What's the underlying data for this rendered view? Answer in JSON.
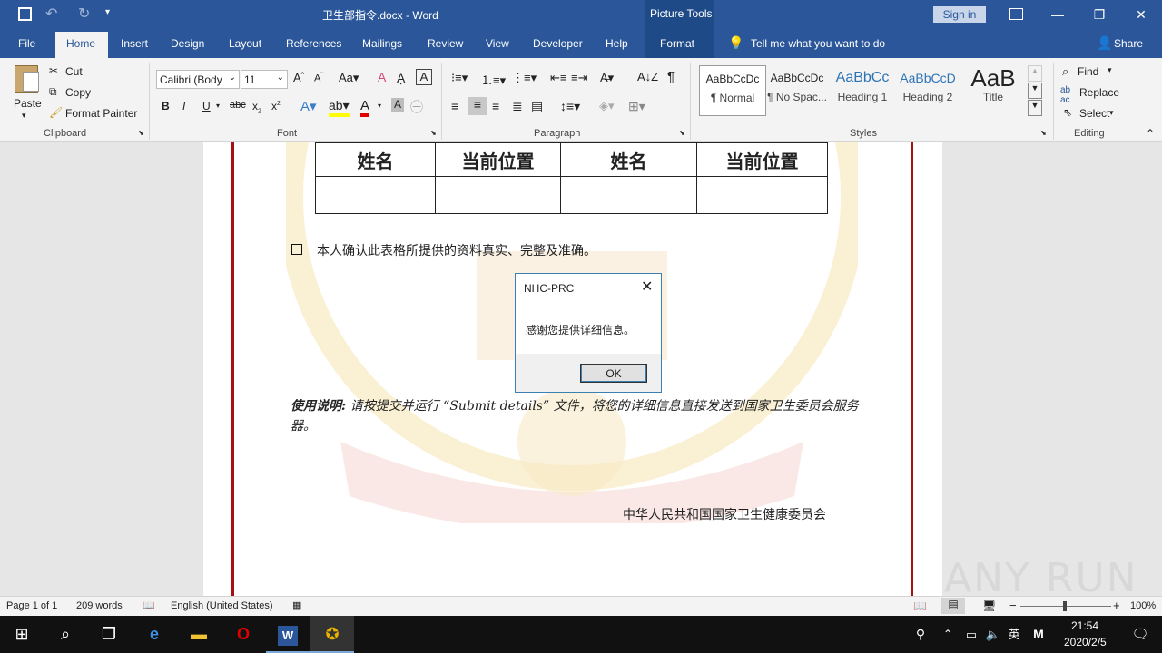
{
  "title_bar": {
    "doc_title": "卫生部指令.docx  -  Word",
    "context_tools": "Picture Tools",
    "sign_in": "Sign in",
    "minimize": "—",
    "restore": "❐",
    "close": "✕"
  },
  "tabs": {
    "file": "File",
    "home": "Home",
    "insert": "Insert",
    "design": "Design",
    "layout": "Layout",
    "references": "References",
    "mailings": "Mailings",
    "review": "Review",
    "view": "View",
    "developer": "Developer",
    "help": "Help",
    "format": "Format",
    "tell_me": "Tell me what you want to do",
    "share": "Share"
  },
  "ribbon": {
    "clipboard": {
      "paste": "Paste",
      "cut": "Cut",
      "copy": "Copy",
      "format_painter": "Format Painter",
      "label": "Clipboard"
    },
    "font": {
      "name": "Calibri (Body",
      "size": "11",
      "label": "Font",
      "bold": "B",
      "italic": "I",
      "underline": "U",
      "strike": "abc"
    },
    "paragraph": {
      "label": "Paragraph"
    },
    "styles": {
      "label": "Styles",
      "items": [
        {
          "preview": "AaBbCcDc",
          "name": "¶ Normal"
        },
        {
          "preview": "AaBbCcDc",
          "name": "¶ No Spac..."
        },
        {
          "preview": "AaBbCc",
          "name": "Heading 1"
        },
        {
          "preview": "AaBbCcD",
          "name": "Heading 2"
        },
        {
          "preview": "AaB",
          "name": "Title"
        }
      ]
    },
    "editing": {
      "find": "Find",
      "replace": "Replace",
      "select": "Select",
      "label": "Editing"
    }
  },
  "document": {
    "table_headers": [
      "姓名",
      "当前位置",
      "姓名",
      "当前位置"
    ],
    "confirm_text": "本人确认此表格所提供的资料真实、完整及准确。",
    "usage_label": "使用说明:",
    "usage_text": " 请按提交并运行 “Submit details” 文件，将您的详细信息直接发送到国家卫生委员会服务器。",
    "signature": "中华人民共和国国家卫生健康委员会"
  },
  "dialog": {
    "title": "NHC-PRC",
    "message": "感谢您提供详细信息。",
    "ok": "OK"
  },
  "status": {
    "page": "Page 1 of 1",
    "words": "209 words",
    "language": "English (United States)",
    "zoom": "100%"
  },
  "watermark": "ANY RUN",
  "taskbar": {
    "time": "21:54",
    "date": "2020/2/5",
    "ime": "英"
  },
  "colors": {
    "word_blue": "#2b579a",
    "page_border_red": "#a80f10"
  }
}
